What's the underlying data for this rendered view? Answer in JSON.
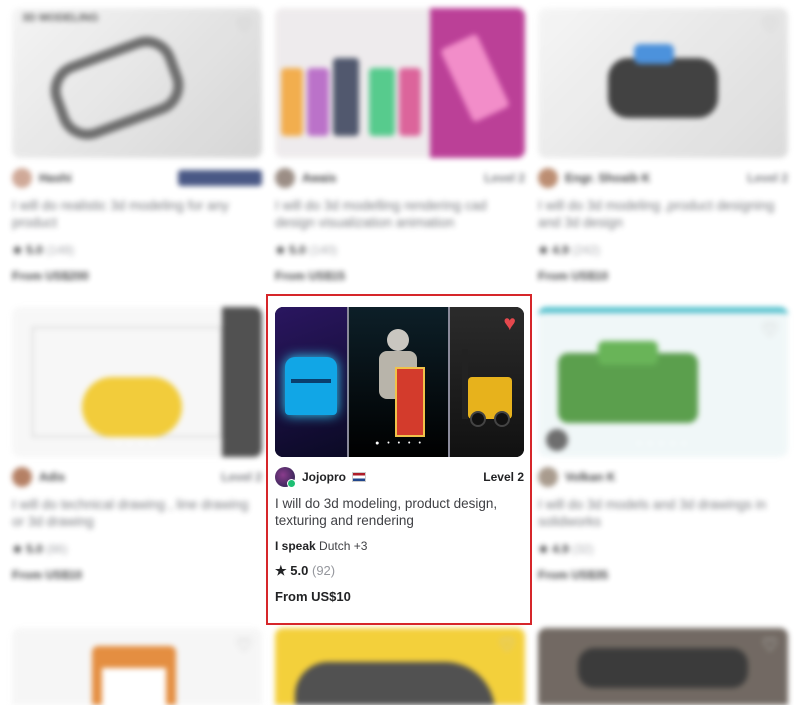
{
  "cards": [
    {
      "seller": "Hashi",
      "level": "",
      "title": "I will do realistic 3d modeling for any product",
      "rating": "5.0",
      "count": "(148)",
      "price": "From US$200",
      "thumb": "#d8d8d8",
      "accent": "#555"
    },
    {
      "seller": "Awais",
      "level": "Level 2",
      "title": "I will do 3d modelling rendering cad design visualization animation",
      "rating": "5.0",
      "count": "(140)",
      "price": "From US$15",
      "thumb": "#e8e2e6",
      "accent": "#c02a8c"
    },
    {
      "seller": "Engr. Shoaib K",
      "level": "Level 2",
      "title": "I will do 3d modeling ,product designing and 3d design",
      "rating": "4.9",
      "count": "(242)",
      "price": "From US$10",
      "thumb": "#e9e9e9",
      "accent": "#2a2a2a"
    },
    {
      "seller": "Adis",
      "level": "Level 2",
      "title": "I will do technical drawing , line drawing or 3d drawing",
      "rating": "5.0",
      "count": "(86)",
      "price": "From US$10",
      "thumb": "#f2f2f2",
      "accent": "#f0c419"
    },
    {
      "seller": "Volkan K",
      "level": "",
      "title": "I will do 3d models and 3d drawings in solidworks",
      "rating": "4.9",
      "count": "(32)",
      "price": "From US$35",
      "thumb": "#d9eef0",
      "accent": "#2f8a2f"
    },
    {
      "seller": "",
      "level": "",
      "title": "",
      "rating": "",
      "count": "",
      "price": "",
      "thumb": "#f5f5f5",
      "accent": "#e07b20"
    },
    {
      "seller": "",
      "level": "",
      "title": "",
      "rating": "",
      "count": "",
      "price": "",
      "thumb": "#f2c81a",
      "accent": "#333"
    },
    {
      "seller": "",
      "level": "",
      "title": "",
      "rating": "",
      "count": "",
      "price": "",
      "thumb": "#4a4a4a",
      "accent": "#222"
    }
  ],
  "focus": {
    "seller": "Jojopro",
    "level": "Level 2",
    "title": "I will do 3d modeling, product design, texturing and rendering",
    "speaks_label": "I speak",
    "speaks_value": "Dutch +3",
    "rating": "5.0",
    "count": "(92)",
    "price": "From US$10",
    "heart_color": "#e5484d",
    "highlight_color": "#d6262a"
  },
  "top_left_watermark": "3D MODELING"
}
